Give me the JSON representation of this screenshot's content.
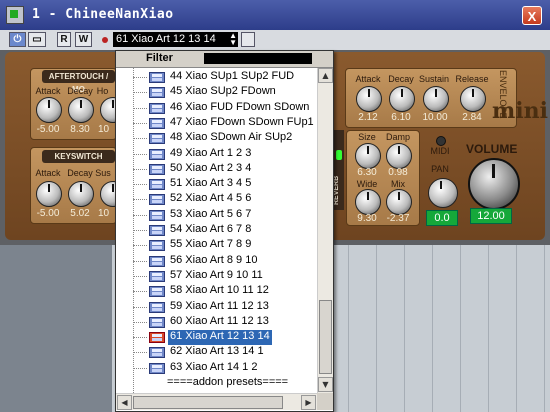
{
  "window": {
    "title": "1 - ChineeNanXiao",
    "close_label": "X"
  },
  "toolbar": {
    "r_label": "R",
    "w_label": "W",
    "preset": "61 Xiao Art 12 13 14"
  },
  "plugin": {
    "sections": {
      "aftertouch": "AFTERTOUCH / MO",
      "keyswitch": "KEYSWITCH",
      "reverb": "REVERB",
      "brand": "mini",
      "brand_sub": "ENVELOPE"
    },
    "aftertouch": {
      "labels": [
        "Attack",
        "Decay",
        "Ho"
      ],
      "values": [
        "-5.00",
        "8.30",
        "10"
      ]
    },
    "keyswitch": {
      "labels": [
        "Attack",
        "Decay",
        "Sus"
      ],
      "values": [
        "-5.00",
        "5.02",
        "10"
      ]
    },
    "envelope": {
      "labels": [
        "Attack",
        "Decay",
        "Sustain",
        "Release"
      ],
      "values": [
        "2.12",
        "6.10",
        "10.00",
        "2.84"
      ]
    },
    "reverb": {
      "labels": [
        "Size",
        "Damp",
        "Wide",
        "Mix"
      ],
      "values": [
        "6.30",
        "0.98",
        "9.30",
        "-2.37"
      ]
    },
    "midi_label": "MIDI",
    "pan": {
      "label": "PAN",
      "value": "0.0"
    },
    "volume": {
      "label": "VOLUME",
      "value": "12.00"
    }
  },
  "popup": {
    "filter_label": "Filter",
    "items": [
      "44 Xiao SUp1 SUp2 FUD",
      "45 Xiao SUp2 FDown",
      "46 Xiao FUD FDown SDown",
      "47 Xiao FDown SDown FUp1",
      "48 Xiao SDown Air SUp2",
      "49 Xiao Art 1 2 3",
      "50 Xiao Art 2 3 4",
      "51 Xiao Art 3 4 5",
      "52 Xiao Art 4 5 6",
      "53 Xiao Art 5 6 7",
      "54 Xiao Art 6 7 8",
      "55 Xiao Art 7 8 9",
      "56 Xiao Art 8 9 10",
      "57 Xiao Art 9 10 11",
      "58 Xiao Art 10 11 12",
      "59 Xiao Art 11 12 13",
      "60 Xiao Art 11 12 13",
      "61 Xiao Art 12 13 14",
      "62 Xiao Art 13 14 1",
      "63 Xiao Art 14 1 2"
    ],
    "selected_index": 17,
    "addon_label": "====addon presets===="
  }
}
